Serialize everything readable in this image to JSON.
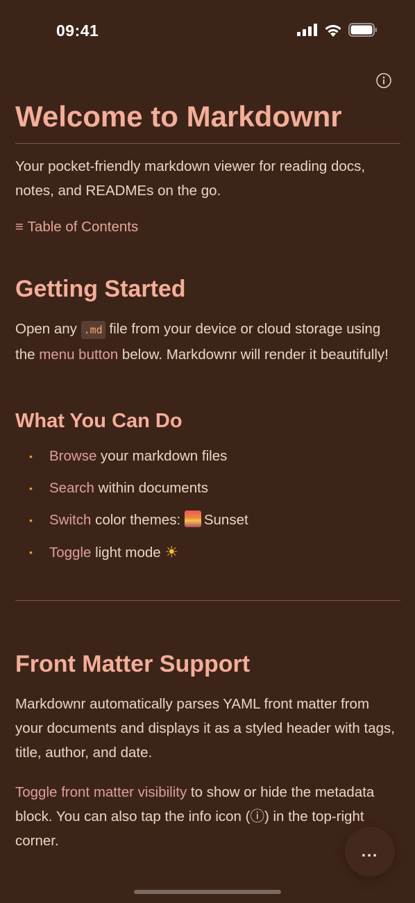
{
  "status": {
    "time": "09:41"
  },
  "doc": {
    "title": "Welcome to Markdownr",
    "intro": "Your pocket-friendly markdown viewer for reading docs, notes, and READMEs on the go.",
    "toc_icon": "≡",
    "toc_label": "Table of Contents",
    "getting_started": {
      "heading": "Getting Started",
      "text_before_code": "Open any ",
      "code": ".md",
      "text_after_code": " file from your device or cloud storage using the ",
      "link": "menu button",
      "text_end": " below. Markdownr will render it beautifully!"
    },
    "what_you_can_do": {
      "heading": "What You Can Do",
      "items": [
        {
          "link": "Browse",
          "text": " your markdown files"
        },
        {
          "link": "Search",
          "text": " within documents"
        },
        {
          "link": "Switch",
          "text": " color themes: ",
          "theme": "Sunset"
        },
        {
          "link": "Toggle",
          "text": " light mode "
        }
      ]
    },
    "front_matter": {
      "heading": "Front Matter Support",
      "para1": "Markdownr automatically parses YAML front matter from your documents and displays it as a styled header with tags, title, author, and date.",
      "link": "Toggle front matter visibility",
      "para2_rest": " to show or hide the metadata block. You can also tap the info icon (ⓘ) in the top-right corner."
    }
  },
  "fab_label": "...",
  "colors": {
    "background": "#3d2419",
    "heading": "#f4ae9a",
    "link": "#dd9ea3",
    "bullet": "#e59a4e"
  }
}
